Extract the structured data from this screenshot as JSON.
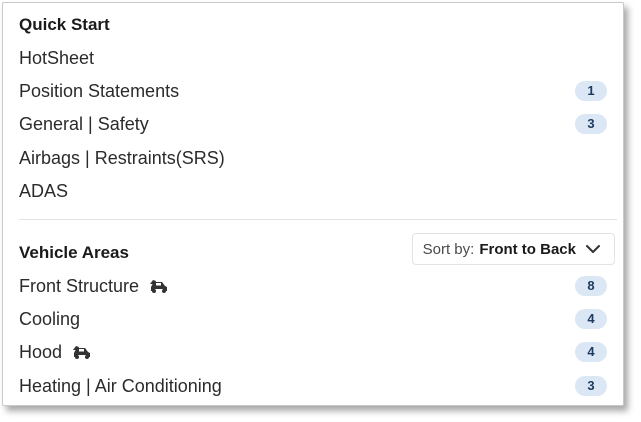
{
  "quick_start": {
    "title": "Quick Start",
    "items": [
      {
        "label": "HotSheet",
        "count": null
      },
      {
        "label": "Position Statements",
        "count": "1"
      },
      {
        "label": "General | Safety",
        "count": "3"
      },
      {
        "label": "Airbags | Restraints(SRS)",
        "count": null
      },
      {
        "label": "ADAS",
        "count": null
      }
    ]
  },
  "vehicle_areas": {
    "title": "Vehicle Areas",
    "sort": {
      "prefix": "Sort by:",
      "value": "Front to Back"
    },
    "items": [
      {
        "label": "Front Structure",
        "count": "8",
        "icon": "car-damage-icon"
      },
      {
        "label": "Cooling",
        "count": "4",
        "icon": null
      },
      {
        "label": "Hood",
        "count": "4",
        "icon": "car-damage-icon"
      },
      {
        "label": "Heating | Air Conditioning",
        "count": "3",
        "icon": null
      }
    ]
  },
  "colors": {
    "badge_bg": "#dbe7f4",
    "badge_text": "#1d3b5e"
  }
}
